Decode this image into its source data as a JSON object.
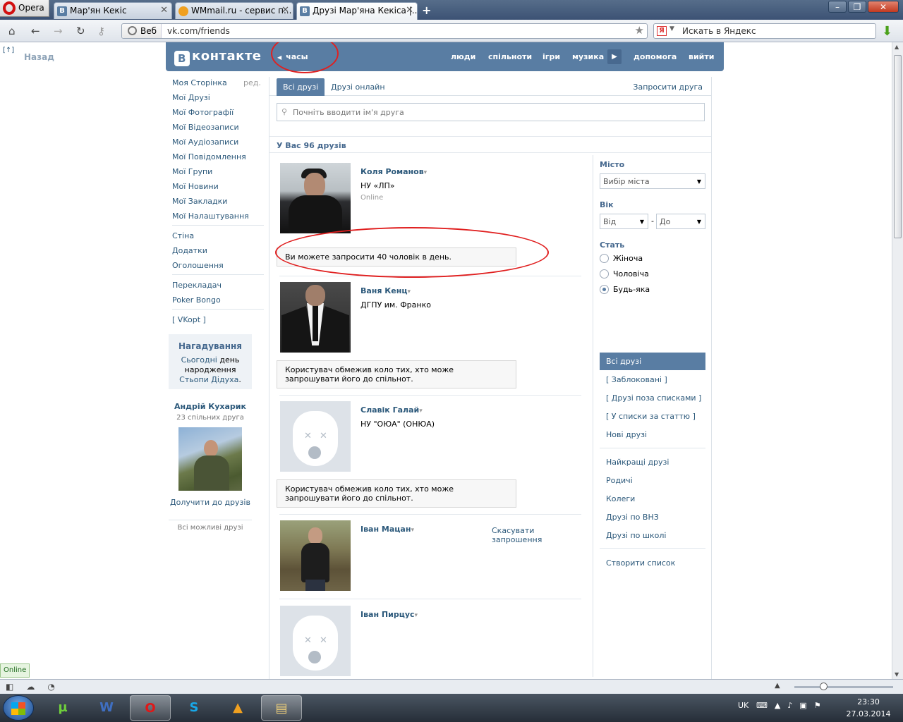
{
  "browser": {
    "menu_label": "Opera",
    "tabs": [
      {
        "title": "Мар'ян Кекіс",
        "icon": "vk-icon"
      },
      {
        "title": "WMmail.ru - сервис п...",
        "icon": "wmmail-icon"
      },
      {
        "title": "Друзі Мар'яна Кекіса |...",
        "icon": "vk-icon",
        "active": true
      }
    ],
    "web_label": "Веб",
    "url": "vk.com/friends",
    "search_placeholder": "Искать в Яндекс",
    "status_online": "Online"
  },
  "page": {
    "back_label": "Назад",
    "back_marker": "[↑]",
    "logo_letter": "В",
    "logo_text": "контакте",
    "clock_label": "часы",
    "nav": [
      "люди",
      "спільноти",
      "ігри",
      "музика",
      "допомога",
      "вийти"
    ]
  },
  "left_menu": {
    "edit_label": "ред.",
    "group1": [
      "Моя Сторінка",
      "Мої Друзі",
      "Мої Фотографії",
      "Мої Відеозаписи",
      "Мої Аудіозаписи",
      "Мої Повідомлення",
      "Мої Групи",
      "Мої Новини",
      "Мої Закладки",
      "Мої Налаштування"
    ],
    "group2": [
      "Стіна",
      "Додатки",
      "Оголошення"
    ],
    "group3": [
      "Перекладач",
      "Poker Bongo"
    ],
    "group4": [
      "[ VKopt ]"
    ]
  },
  "reminder": {
    "title": "Нагадування",
    "today": "Сьогодні",
    "text_mid": " день народження ",
    "person": "Стьопи Дідуха",
    "end": "."
  },
  "suggestion": {
    "name": "Андрій Кухарик",
    "common": "23 спільних друга",
    "add_label": "Долучити до друзів",
    "all_label": "Всі можливі друзі"
  },
  "friends_tabs": {
    "all": "Всі друзі",
    "online": "Друзі онлайн",
    "invite": "Запросити друга"
  },
  "search_placeholder": "Почніть вводити ім'я друга",
  "friends_count_label": "У Вас 96 друзів",
  "friends": [
    {
      "name": "Коля Романов",
      "dropdown": "▾",
      "university": "НУ «ЛП»",
      "status": "Online",
      "message": "Ви можете запросити 40 чоловік в день."
    },
    {
      "name": "Ваня Кенц",
      "dropdown": "▾",
      "university": "ДГПУ им. Франко",
      "message": "Користувач обмежив коло тих, хто може запрошувати його до спільнот."
    },
    {
      "name": "Славік Галай",
      "dropdown": "▾",
      "university": "НУ \"ОЮА\" (ОНЮА)",
      "message": "Користувач обмежив коло тих, хто може запрошувати його до спільнот."
    },
    {
      "name": "Іван Мацан",
      "dropdown": "▾",
      "action": "Скасувати запрошення"
    },
    {
      "name": "Іван Пирцус",
      "dropdown": "▾"
    }
  ],
  "filters": {
    "city_label": "Місто",
    "city_value": "Вибір міста",
    "age_label": "Вік",
    "age_from": "Від",
    "age_dash": "-",
    "age_to": "До",
    "sex_label": "Стать",
    "sex_options": [
      "Жіноча",
      "Чоловіча",
      "Будь-яка"
    ],
    "sex_selected_index": 2,
    "lists1": [
      "Всі друзі",
      "[ Заблоковані ]",
      "[ Друзі поза списками ]",
      "[ У списки за статтю ]",
      "Нові друзі"
    ],
    "lists2": [
      "Найкращі друзі",
      "Родичі",
      "Колеги",
      "Друзі по ВНЗ",
      "Друзі по школі"
    ],
    "create_list": "Створити список"
  },
  "tray": {
    "lang": "UK",
    "time": "23:30",
    "date": "27.03.2014"
  },
  "colors": {
    "vk_blue": "#597da3",
    "link": "#2b587a",
    "annotation_red": "#e02020"
  }
}
